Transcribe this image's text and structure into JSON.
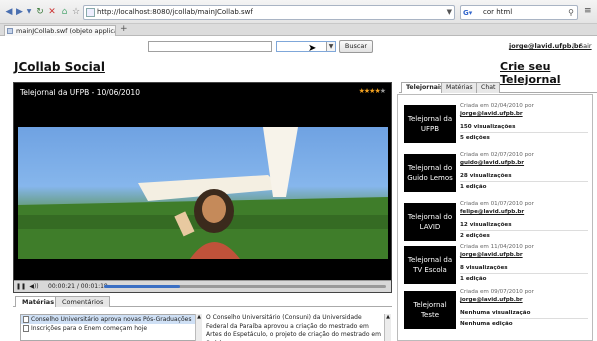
{
  "browser": {
    "url": "http://localhost:8080/jcollab/mainJCollab.swf",
    "search_query": "cor html",
    "tab_title": "mainJCollab.swf (objeto applica...",
    "new_tab_symbol": "+"
  },
  "header": {
    "search_button": "Buscar",
    "user_email": "jorge@lavid.ufpb.br",
    "separator": "|",
    "logout": "Sair",
    "app_title": "JCollab Social",
    "create_link": "Crie seu Telejornal"
  },
  "video": {
    "title": "Telejornal da UFPB - 10/06/2010",
    "time": "00:00:21 / 00:01:18",
    "progress": 0.27,
    "rating": 4,
    "rating_max": 5
  },
  "bottom_tabs": [
    "Matérias",
    "Comentários"
  ],
  "news_list": [
    "Conselho Universitário aprova novas Pós-Graduações",
    "Inscrições para o Enem começam hoje"
  ],
  "news_text": "O Conselho Universitário (Consuni) da Universidade Federal da Paraíba aprovou a criação do mestrado em Artes do Espetáculo, o projeto de criação do mestrado em Saúde",
  "right_tabs": [
    "Telejornais",
    "Matérias",
    "Chat"
  ],
  "telejornais": [
    {
      "name": "Telejornal da UFPB",
      "created": "Criada em 02/04/2010 por",
      "author": "jorge@lavid.ufpb.br",
      "views": "150 visualizações",
      "editions": "5 edições"
    },
    {
      "name": "Telejornal do Guido Lemos",
      "created": "Criada em 02/07/2010 por",
      "author": "guido@lavid.ufpb.br",
      "views": "28 visualizações",
      "editions": "1 edição"
    },
    {
      "name": "Telejornal do LAVID",
      "created": "Criada em 01/07/2010 por",
      "author": "felipe@lavid.ufpb.br",
      "views": "12 visualizações",
      "editions": "2 edições"
    },
    {
      "name": "Telejornal da TV Escola",
      "created": "Criada em 11/04/2010 por",
      "author": "jorge@lavid.ufpb.br",
      "views": "8 visualizações",
      "editions": "1 edição"
    },
    {
      "name": "Telejornal Teste",
      "created": "Criada em 09/07/2010 por",
      "author": "jorge@lavid.ufpb.br",
      "views": "Nenhuma visualização",
      "editions": "Nenhuma edição"
    }
  ]
}
